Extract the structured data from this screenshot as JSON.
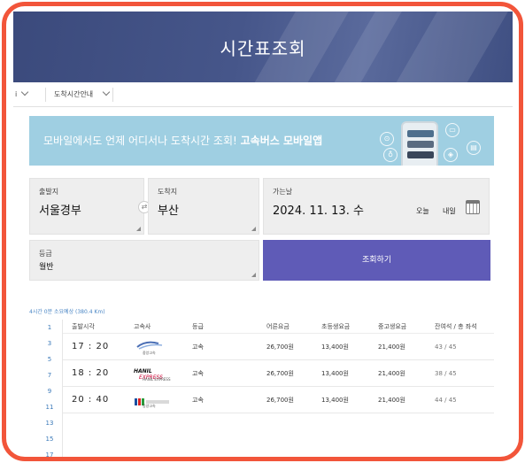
{
  "page": {
    "title": "시간표조회"
  },
  "tabs": {
    "first_label": "i",
    "second_label": "도착시간안내"
  },
  "banner": {
    "text_normal": "모바일에서도 언제 어디서나 도착시간 조회!",
    "text_bold": "고속버스 모바일앱"
  },
  "form": {
    "departure": {
      "label": "출발지",
      "value": "서울경부"
    },
    "arrival": {
      "label": "도착지",
      "value": "부산"
    },
    "date": {
      "label": "가는날",
      "value": "2024. 11. 13. 수",
      "today": "오늘",
      "tomorrow": "내일"
    },
    "grade": {
      "label": "등급",
      "value": "월반"
    },
    "search_label": "조회하기"
  },
  "results": {
    "summary": "4시간 0분 소요예상 (380.4 Km)",
    "left_numbers": [
      "1",
      "3",
      "5",
      "7",
      "9",
      "11",
      "13",
      "15",
      "17"
    ],
    "columns": [
      "출발시각",
      "고속사",
      "등급",
      "어른요금",
      "초등생요금",
      "중고생요금",
      "잔여석 / 총 좌석"
    ],
    "rows": [
      {
        "time": "17 : 20",
        "company": "중앙고속",
        "grade": "고속",
        "adult": "26,700원",
        "child": "13,400원",
        "student": "21,400원",
        "seats": "43 / 45"
      },
      {
        "time": "18 : 20",
        "company": "HANIL EXPRESS",
        "grade": "고속",
        "adult": "26,700원",
        "child": "13,400원",
        "student": "21,400원",
        "seats": "38 / 45"
      },
      {
        "time": "20 : 40",
        "company": "동양고속",
        "grade": "고속",
        "adult": "26,700원",
        "child": "13,400원",
        "student": "21,400원",
        "seats": "44 / 45"
      }
    ]
  },
  "colors": {
    "accent": "#5f5bb7",
    "hero": "#46568a",
    "banner": "#9fcfe2",
    "frame": "#f2553a"
  },
  "icons": [
    "swap-icon",
    "calendar-icon",
    "chevron-down-icon",
    "phone-icon"
  ]
}
